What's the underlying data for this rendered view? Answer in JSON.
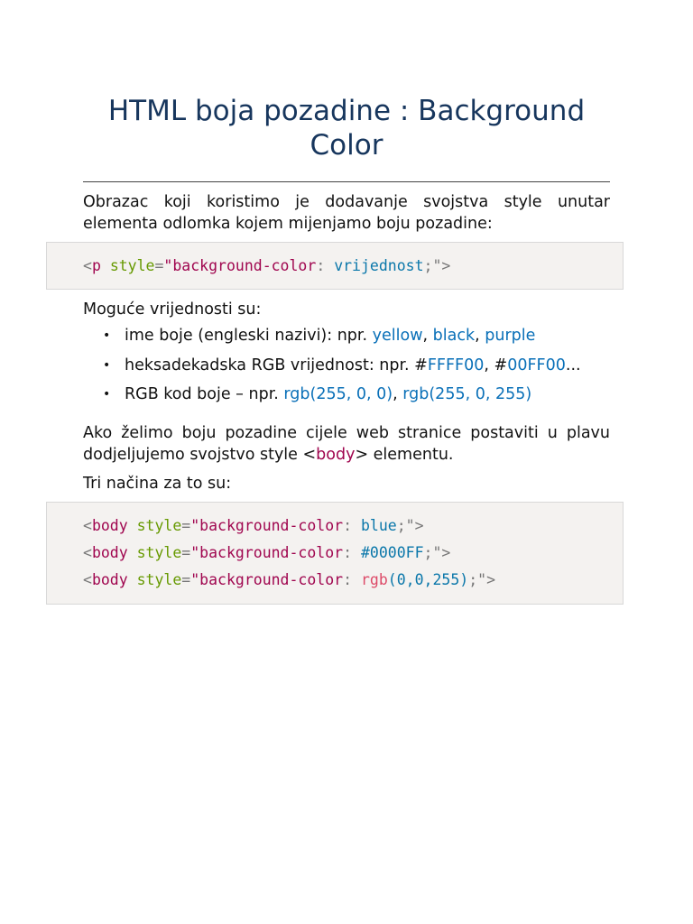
{
  "title": "HTML boja pozadine : Background Color",
  "intro": "Obrazac koji koristimo je dodavanje svojstva style unutar elementa odlomka kojem mijenjamo boju pozadine:",
  "code1": [
    [
      {
        "k": "punct",
        "t": "<"
      },
      {
        "k": "tag",
        "t": "p "
      },
      {
        "k": "attr",
        "t": "style"
      },
      {
        "k": "punct",
        "t": "="
      },
      {
        "k": "str",
        "t": "\"background-color"
      },
      {
        "k": "punct",
        "t": ": "
      },
      {
        "k": "val",
        "t": "vrijednost"
      },
      {
        "k": "punct",
        "t": ";\">"
      }
    ]
  ],
  "values_heading": "Moguće vrijednosti su:",
  "list": [
    {
      "prefix": "ime boje (engleski nazivi): npr. ",
      "parts": [
        "yellow",
        ", ",
        "black",
        ", ",
        "purple"
      ],
      "suffix": ""
    },
    {
      "prefix": "heksadekadska RGB vrijednost: npr. #",
      "parts": [
        "FFFF00",
        ", #",
        "00FF00"
      ],
      "suffix": "..."
    },
    {
      "prefix": "RGB kod boje – npr. ",
      "parts": [
        "rgb(255, 0, 0)",
        ", ",
        "rgb(255, 0, 255)"
      ],
      "suffix": ""
    }
  ],
  "para2": {
    "before": "Ako želimo boju pozadine cijele web stranice postaviti u plavu dodjeljujemo svojstvo style <",
    "tag": "body",
    "after": "> elementu."
  },
  "para3": "Tri načina za to su:",
  "code2": [
    [
      {
        "k": "punct",
        "t": "<"
      },
      {
        "k": "tag",
        "t": "body "
      },
      {
        "k": "attr",
        "t": "style"
      },
      {
        "k": "punct",
        "t": "="
      },
      {
        "k": "str",
        "t": "\"background-color"
      },
      {
        "k": "punct",
        "t": ": "
      },
      {
        "k": "val",
        "t": "blue"
      },
      {
        "k": "punct",
        "t": ";\">"
      }
    ],
    [
      {
        "k": "punct",
        "t": "<"
      },
      {
        "k": "tag",
        "t": "body "
      },
      {
        "k": "attr",
        "t": "style"
      },
      {
        "k": "punct",
        "t": "="
      },
      {
        "k": "str",
        "t": "\"background-color"
      },
      {
        "k": "punct",
        "t": ": "
      },
      {
        "k": "val",
        "t": "#0000FF"
      },
      {
        "k": "punct",
        "t": ";\">"
      }
    ],
    [
      {
        "k": "punct",
        "t": "<"
      },
      {
        "k": "tag",
        "t": "body "
      },
      {
        "k": "attr",
        "t": "style"
      },
      {
        "k": "punct",
        "t": "="
      },
      {
        "k": "str",
        "t": "\"background-color"
      },
      {
        "k": "punct",
        "t": ": "
      },
      {
        "k": "fn",
        "t": "rgb"
      },
      {
        "k": "val",
        "t": "(0,0,255)"
      },
      {
        "k": "punct",
        "t": ";\">"
      }
    ]
  ]
}
